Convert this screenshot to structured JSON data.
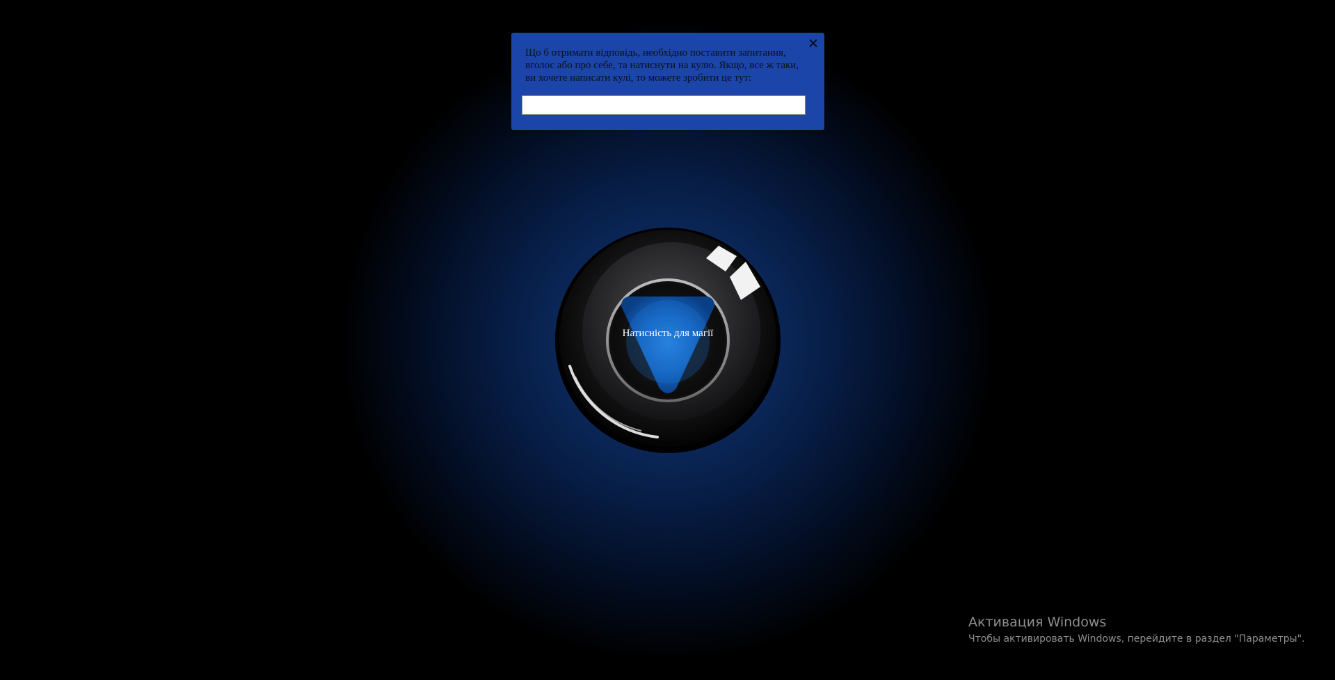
{
  "dialog": {
    "instructions": "Що б отримати відповідь, необхідно поставити запитання, вголос або про себе, та натиснути на кулю. Якщо, все ж таки, ви хочете написати кулі, то можете зробити це тут:",
    "input_value": "",
    "input_placeholder": "",
    "close_icon": "close-icon"
  },
  "ball": {
    "label": "Натисність для магії",
    "window_color": "#1565c0"
  },
  "watermark": {
    "title": "Активация Windows",
    "subtitle": "Чтобы активировать Windows, перейдите в раздел \"Параметры\"."
  },
  "colors": {
    "background_glow": "#123a7a",
    "panel": "#1b45a8"
  }
}
